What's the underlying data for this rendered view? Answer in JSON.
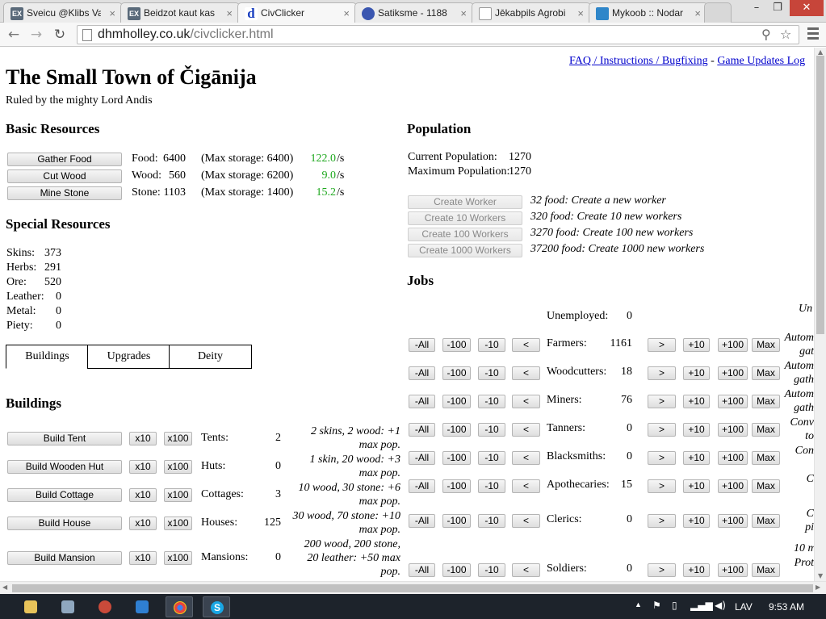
{
  "browser": {
    "tabs": [
      {
        "title": "Sveicu @Klibs Va",
        "favicon_label": "EX",
        "favicon_color": "#5a6a7a"
      },
      {
        "title": "Beidzot kaut kas",
        "favicon_label": "EX",
        "favicon_color": "#5a6a7a"
      },
      {
        "title": "CivClicker",
        "favicon_label": "d",
        "favicon_color": "#1a3fbf",
        "active": true
      },
      {
        "title": "Satiksme - 1188",
        "favicon_label": "",
        "favicon_color": "#3a56b0"
      },
      {
        "title": "Jēkabpils Agrobi",
        "favicon_label": "",
        "favicon_color": "#ffffff"
      },
      {
        "title": "Mykoob :: Nodar",
        "favicon_label": "",
        "favicon_color": "#2f86c9"
      }
    ],
    "close_glyph": "×",
    "url_domain": "dhmholley.co.uk",
    "url_path": "/civclicker.html",
    "nav_icons": {
      "back": "←",
      "forward": "→",
      "reload": "↻",
      "zoom": "⚲",
      "star": "☆"
    },
    "window_buttons": {
      "minimize": "–",
      "maximize": "❐",
      "close": "✕"
    }
  },
  "header": {
    "faq_link": "FAQ / Instructions / Bugfixing",
    "separator": "-",
    "updates_link": "Game Updates Log",
    "title": "The Small Town of Čigānija",
    "ruler": "Ruled by the mighty Lord Andis"
  },
  "basic": {
    "heading": "Basic Resources",
    "rows": [
      {
        "button": "Gather Food",
        "name": "Food:",
        "value": "6400",
        "storage": "(Max storage: 6400)",
        "rate": "122.0",
        "unit": "/s"
      },
      {
        "button": "Cut Wood",
        "name": "Wood:",
        "value": "560",
        "storage": "(Max storage: 6200)",
        "rate": "9.0",
        "unit": "/s"
      },
      {
        "button": "Mine Stone",
        "name": "Stone:",
        "value": "1103",
        "storage": "(Max storage: 1400)",
        "rate": "15.2",
        "unit": "/s"
      }
    ]
  },
  "special": {
    "heading": "Special Resources",
    "rows": [
      {
        "name": "Skins:",
        "value": "373"
      },
      {
        "name": "Herbs:",
        "value": "291"
      },
      {
        "name": "Ore:",
        "value": "520"
      },
      {
        "name": "Leather:",
        "value": "0"
      },
      {
        "name": "Metal:",
        "value": "0"
      },
      {
        "name": "Piety:",
        "value": "0"
      }
    ]
  },
  "panel_tabs": [
    "Buildings",
    "Upgrades",
    "Deity"
  ],
  "buildings": {
    "heading": "Buildings",
    "x10": "x10",
    "x100": "x100",
    "rows": [
      {
        "button": "Build Tent",
        "name": "Tents:",
        "count": "2",
        "cost": "2 skins, 2 wood: +1 max pop."
      },
      {
        "button": "Build Wooden Hut",
        "name": "Huts:",
        "count": "0",
        "cost": "1 skin, 20 wood: +3 max pop."
      },
      {
        "button": "Build Cottage",
        "name": "Cottages:",
        "count": "3",
        "cost": "10 wood, 30 stone: +6 max pop."
      },
      {
        "button": "Build House",
        "name": "Houses:",
        "count": "125",
        "cost": "30 wood, 70 stone: +10 max pop."
      },
      {
        "button": "Build Mansion",
        "name": "Mansions:",
        "count": "0",
        "cost": "200 wood, 200 stone, 20 leather: +50 max pop."
      }
    ]
  },
  "population": {
    "heading": "Population",
    "current_label": "Current Population:",
    "current": "1270",
    "max_label": "Maximum Population:",
    "max": "1270",
    "create": [
      {
        "button": "Create Worker",
        "cost": "32 food: Create a new worker"
      },
      {
        "button": "Create 10 Workers",
        "cost": "320 food: Create 10 new workers"
      },
      {
        "button": "Create 100 Workers",
        "cost": "3270 food: Create 100 new workers"
      },
      {
        "button": "Create 1000 Workers",
        "cost": "37200 food: Create 1000 new workers"
      }
    ]
  },
  "jobs": {
    "heading": "Jobs",
    "unemployed_label": "Unemployed:",
    "unemployed": "0",
    "controls": {
      "all": "-All",
      "m100": "-100",
      "m10": "-10",
      "m1": "<",
      "p1": ">",
      "p10": "+10",
      "p100": "+100",
      "max": "Max"
    },
    "rows": [
      {
        "name": "Farmers:",
        "count": "1161",
        "desc": [
          "Autom",
          "gat"
        ]
      },
      {
        "name": "Woodcutters:",
        "count": "18",
        "desc": [
          "Autom",
          "gath"
        ]
      },
      {
        "name": "Miners:",
        "count": "76",
        "desc": [
          "Autom",
          "gath"
        ]
      },
      {
        "name": "Tanners:",
        "count": "0",
        "desc": [
          "Conv",
          "to"
        ]
      },
      {
        "name": "Blacksmiths:",
        "count": "0",
        "desc": [
          "Con",
          ""
        ]
      },
      {
        "name": "Apothecaries:",
        "count": "15",
        "desc": [
          "C",
          ""
        ]
      },
      {
        "name": "Clerics:",
        "count": "0",
        "desc": [
          "C",
          "pi"
        ]
      },
      {
        "name": "Soldiers:",
        "count": "0",
        "desc": [
          "Prot",
          ""
        ]
      }
    ],
    "side_top": "Un",
    "side_mid": "10 m"
  },
  "taskbar": {
    "language": "LAV",
    "clock": "9:53 AM"
  }
}
